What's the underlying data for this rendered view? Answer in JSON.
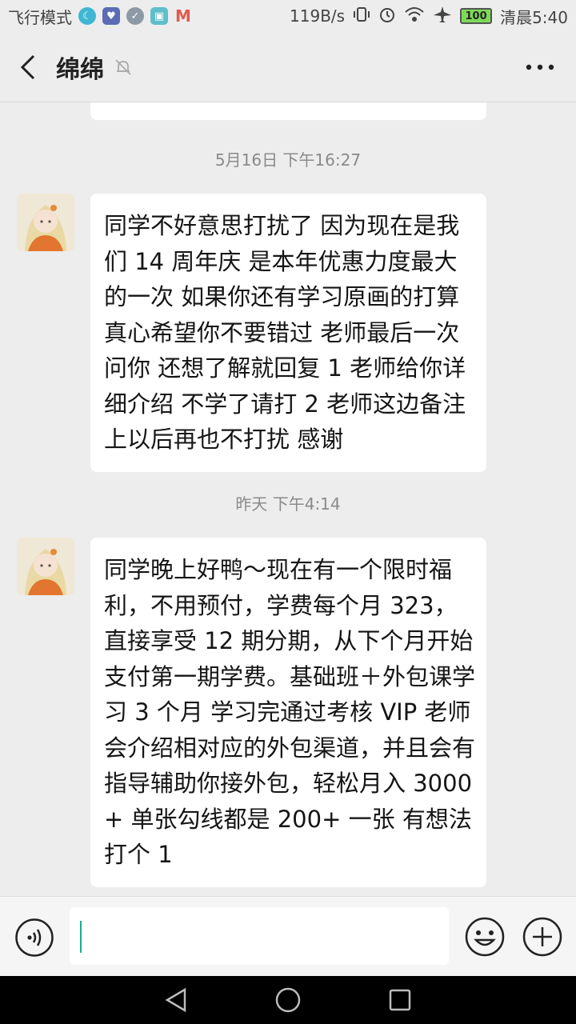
{
  "status_bar": {
    "left_text": "飞行模式",
    "net_speed": "119B/s",
    "battery": "100",
    "time": "清晨5:40",
    "icons": [
      "moon-icon",
      "app-icon",
      "check-icon",
      "gallery-icon",
      "gmail-icon",
      "vibrate-icon",
      "alarm-icon",
      "wifi-icon",
      "airplane-icon",
      "battery-icon"
    ]
  },
  "header": {
    "title": "绵绵",
    "icons": [
      "back-arrow-icon",
      "mute-bell-icon",
      "more-dots-icon"
    ]
  },
  "messages": [
    {
      "timestamp": "5月16日 下午16:27",
      "text": "同学不好意思打扰了 因为现在是我们 14 周年庆 是本年优惠力度最大的一次 如果你还有学习原画的打算 真心希望你不要错过 老师最后一次问你 还想了解就回复 1 老师给你详细介绍 不学了请打 2 老师这边备注上以后再也不打扰 感谢"
    },
    {
      "timestamp": "昨天 下午4:14",
      "text": "同学晚上好鸭～现在有一个限时福利，不用预付，学费每个月 323，直接享受 12 期分期，从下个月开始支付第一期学费。基础班＋外包课学习 3 个月 学习完通过考核 VIP 老师会介绍相对应的外包渠道，并且会有指导辅助你接外包，轻松月入 3000+ 单张勾线都是 200+ 一张 有想法打个 1"
    }
  ],
  "input_bar": {
    "value": "",
    "icons": [
      "voice-icon",
      "emoji-icon",
      "plus-icon"
    ]
  },
  "colors": {
    "background": "#ededed",
    "bubble": "#ffffff",
    "caret": "#1aad8e"
  }
}
